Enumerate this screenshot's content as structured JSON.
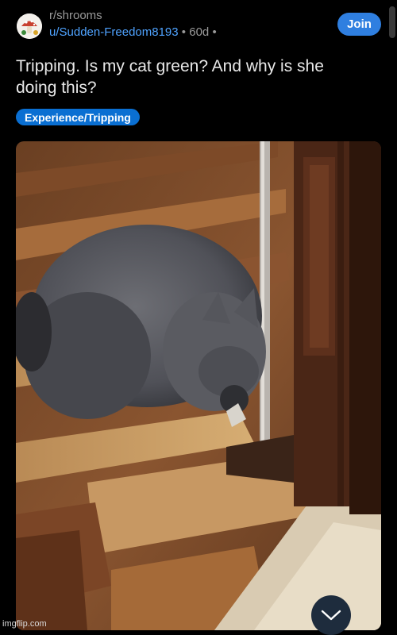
{
  "header": {
    "subreddit": "r/shrooms",
    "username": "u/Sudden-Freedom8193",
    "separator": "•",
    "age": "60d",
    "join_label": "Join"
  },
  "post": {
    "title": "Tripping. Is my cat green? And why is she doing this?",
    "flair": "Experience/Tripping"
  },
  "icons": {
    "avatar": "mushroom-avatar-icon",
    "collapse": "chevron-down-icon"
  },
  "watermark": "imgflip.com",
  "colors": {
    "background": "#000000",
    "accent": "#2f7fe0",
    "flair": "#0a6fd2",
    "username": "#4fa3ff"
  }
}
